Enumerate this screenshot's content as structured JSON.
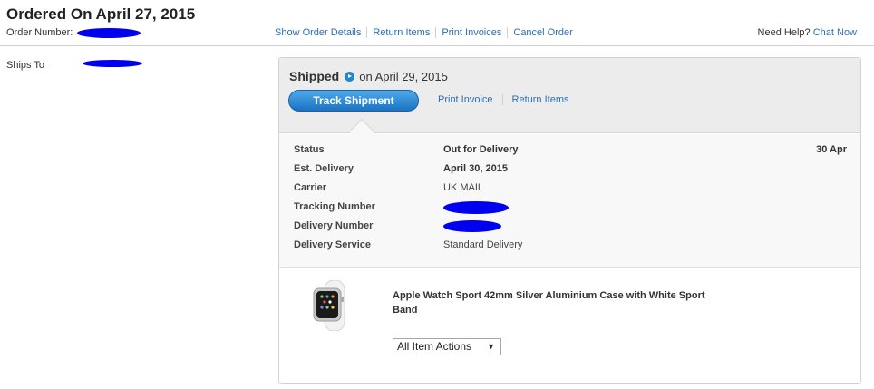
{
  "order": {
    "title": "Ordered On April 27, 2015",
    "number_label": "Order Number:",
    "links": [
      "Show Order Details",
      "Return Items",
      "Print Invoices",
      "Cancel Order"
    ]
  },
  "help": {
    "label": "Need Help?",
    "link": "Chat Now"
  },
  "ships_to": {
    "label": "Ships To"
  },
  "shipment": {
    "status_title": "Shipped",
    "status_date": "on April 29, 2015",
    "track_button": "Track Shipment",
    "links": [
      "Print Invoice",
      "Return Items"
    ],
    "date_right": "30 Apr",
    "details": [
      {
        "label": "Status",
        "value": "Out for Delivery"
      },
      {
        "label": "Est. Delivery",
        "value": "April 30, 2015"
      },
      {
        "label": "Carrier",
        "value": "UK MAIL"
      },
      {
        "label": "Tracking Number",
        "value": ""
      },
      {
        "label": "Delivery Number",
        "value": ""
      },
      {
        "label": "Delivery Service",
        "value": "Standard Delivery"
      }
    ]
  },
  "item": {
    "name": "Apple Watch Sport 42mm Silver Aluminium Case with White Sport Band",
    "actions_select": "All Item Actions"
  },
  "colors": {
    "link": "#2a6fb5",
    "button": "#1a73c4",
    "redaction": "#0000ee"
  }
}
